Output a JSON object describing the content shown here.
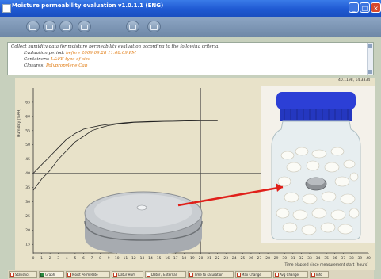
{
  "window": {
    "title": "Moisture permeability evaluation v1.0.1.1 (ENG)"
  },
  "criteria": {
    "intro": "Collect humidity data for moisture permeability evaluation according to the following criteria:",
    "period_label": "Evaluation period:",
    "period_value": "before 2009.09.28 11:08:09 PM",
    "containers_label": "Containers:",
    "containers_value": "L&FE type of size",
    "closures_label": "Closures:",
    "closures_value": "Polypropylene Cap"
  },
  "graph": {
    "coords_readout": "40.1198, 14.3334",
    "y_axis_label": "Humidity [%RH]",
    "x_axis_label": "Time elapsed since measurement start (hours)",
    "colors": {
      "curve": "#222222",
      "plot_bg": "#e8e2c9",
      "arrow": "#e0201a",
      "cap": "#2c3fd6"
    }
  },
  "chart_data": {
    "type": "line",
    "ylabel": "Humidity [%RH]",
    "xlabel": "Time elapsed since measurement start (hours)",
    "xlim": [
      0,
      40
    ],
    "ylim": [
      12,
      70
    ],
    "grid": false,
    "x_ticks": [
      "0",
      "1",
      "2",
      "3",
      "4",
      "5",
      "6",
      "7",
      "8",
      "9",
      "10",
      "11",
      "12",
      "13",
      "14",
      "15",
      "16",
      "17",
      "18",
      "19",
      "20",
      "21",
      "22",
      "23",
      "24",
      "25",
      "26",
      "27",
      "28",
      "29",
      "30",
      "31",
      "32",
      "33",
      "34",
      "35",
      "36",
      "37",
      "38",
      "39",
      "40"
    ],
    "y_ticks": [
      "15",
      "20",
      "25",
      "30",
      "35",
      "40",
      "45",
      "50",
      "55",
      "60",
      "65"
    ],
    "series": [
      {
        "x": [
          0,
          1,
          2,
          3,
          4,
          5,
          6,
          7,
          8,
          9,
          10,
          11,
          12,
          14,
          16,
          18,
          20,
          22
        ],
        "y": [
          40,
          43,
          46,
          49,
          52,
          54,
          55.5,
          56.2,
          56.8,
          57.2,
          57.5,
          57.8,
          58,
          58.2,
          58.3,
          58.4,
          58.5,
          58.5
        ]
      },
      {
        "x": [
          0,
          1,
          2,
          3,
          4,
          5,
          6,
          7,
          8,
          9,
          10,
          11,
          12,
          14,
          16,
          18,
          20,
          22
        ],
        "y": [
          34,
          38,
          41,
          45,
          48,
          51,
          53,
          55,
          56,
          56.8,
          57.3,
          57.6,
          57.9,
          58.1,
          58.3,
          58.4,
          58.5,
          58.5
        ]
      }
    ],
    "crosshair": {
      "x": 20,
      "y": 40
    }
  },
  "tabs": [
    {
      "label": "Statistics",
      "active": false
    },
    {
      "label": "Graph",
      "active": true
    },
    {
      "label": "Moist Perm Rate",
      "active": false
    },
    {
      "label": "Datur Hum",
      "active": false
    },
    {
      "label": "Datur / External",
      "active": false
    },
    {
      "label": "Time to saturation",
      "active": false
    },
    {
      "label": "Max Change",
      "active": false
    },
    {
      "label": "Avg Change",
      "active": false
    },
    {
      "label": "Info",
      "active": false
    }
  ]
}
